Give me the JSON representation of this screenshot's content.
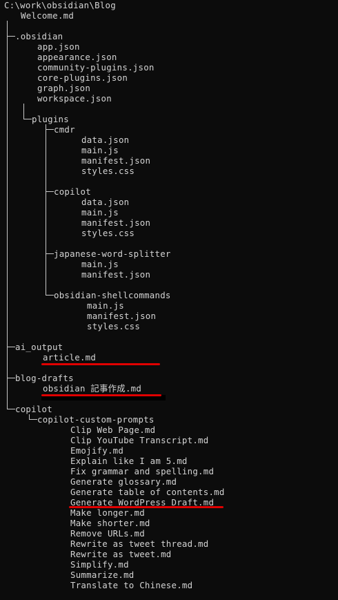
{
  "terminal": {
    "path": "C:\\work\\obsidian\\Blog",
    "root_files": [
      "Welcome.md"
    ],
    "obsidian_dir": {
      "name": ".obsidian",
      "files": [
        "app.json",
        "appearance.json",
        "community-plugins.json",
        "core-plugins.json",
        "graph.json",
        "workspace.json"
      ],
      "plugins_dir": {
        "name": "plugins",
        "cmdr": {
          "name": "cmdr",
          "files": [
            "data.json",
            "main.js",
            "manifest.json",
            "styles.css"
          ]
        },
        "copilot": {
          "name": "copilot",
          "files": [
            "data.json",
            "main.js",
            "manifest.json",
            "styles.css"
          ]
        },
        "japanese": {
          "name": "japanese-word-splitter",
          "files": [
            "main.js",
            "manifest.json"
          ]
        },
        "shell": {
          "name": "obsidian-shellcommands",
          "files": [
            "main.js",
            "manifest.json",
            "styles.css"
          ]
        }
      }
    },
    "ai_output": {
      "name": "ai_output",
      "files": [
        "article.md"
      ]
    },
    "blog_drafts": {
      "name": "blog-drafts",
      "files": [
        "obsidian 記事作成.md"
      ]
    },
    "copilot_dir": {
      "name": "copilot",
      "prompts_dir": {
        "name": "copilot-custom-prompts",
        "files": [
          "Clip Web Page.md",
          "Clip YouTube Transcript.md",
          "Emojify.md",
          "Explain like I am 5.md",
          "Fix grammar and spelling.md",
          "Generate glossary.md",
          "Generate table of contents.md",
          "Generate WordPress Draft.md",
          "Make longer.md",
          "Make shorter.md",
          "Remove URLs.md",
          "Rewrite as tweet thread.md",
          "Rewrite as tweet.md",
          "Simplify.md",
          "Summarize.md",
          "Translate to Chinese.md"
        ]
      }
    },
    "colors": {
      "background": "#0c0c0c",
      "text": "#d4d4d4",
      "highlight_underline": "#e00000"
    }
  }
}
